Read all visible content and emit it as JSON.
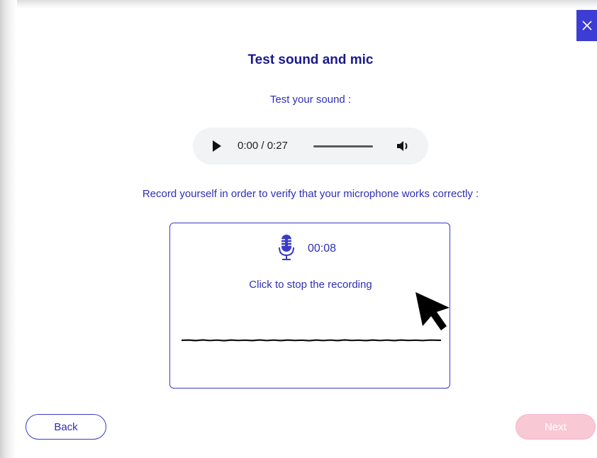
{
  "dialog": {
    "title": "Test sound and mic",
    "sound_prompt": "Test your sound :",
    "record_prompt": "Record yourself in order to verify that your microphone works correctly :",
    "close_icon": "close-icon"
  },
  "audio_player": {
    "time": "0:00 / 0:27",
    "play_icon": "play-icon",
    "volume_icon": "volume-icon"
  },
  "recorder": {
    "elapsed": "00:08",
    "instruction": "Click to stop the recording",
    "mic_icon": "microphone-icon"
  },
  "footer": {
    "back_label": "Back",
    "next_label": "Next"
  },
  "colors": {
    "primary": "#2f2fb8",
    "title": "#1a1a8c",
    "close_bg": "#3d3dd6",
    "next_disabled_bg": "#f8c8d4"
  }
}
